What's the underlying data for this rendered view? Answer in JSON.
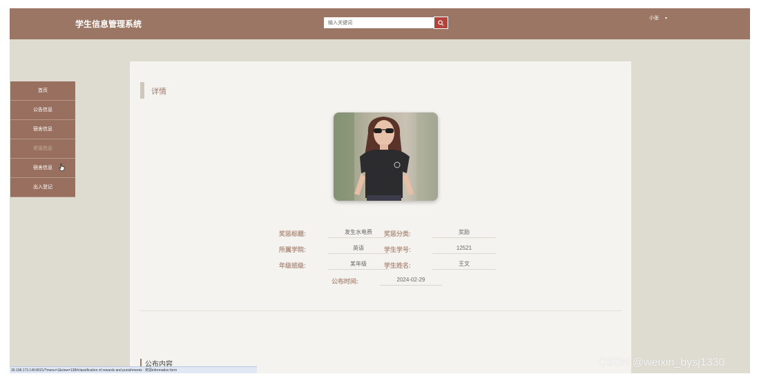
{
  "header": {
    "app_title": "学生信息管理系统",
    "search_placeholder": "输入关键词",
    "user_name": "小张",
    "user_caret": "▾"
  },
  "sidebar": {
    "items": [
      {
        "label": "首页"
      },
      {
        "label": "公告信息"
      },
      {
        "label": "宿舍信息"
      },
      {
        "label": "奖惩信息",
        "active": true
      },
      {
        "label": "宿舍信息"
      },
      {
        "label": "出入登记"
      }
    ]
  },
  "detail": {
    "section_title": "详情",
    "fields": {
      "title_label": "奖惩标题:",
      "title_value": "发生水电费",
      "category_label": "奖惩分类:",
      "category_value": "奖励",
      "college_label": "所属学院:",
      "college_value": "英语",
      "student_no_label": "学生学号:",
      "student_no_value": "12521",
      "grade_label": "年级班级:",
      "grade_value": "某年级",
      "student_name_label": "学生姓名:",
      "student_name_value": "王文",
      "publish_time_label": "公布时间:",
      "publish_time_value": "2024-02-29"
    },
    "content_title": "公布内容"
  },
  "statusbar": {
    "text": "39.108.173.140:8021/?menu=1&view=138#classification of rewards and punishments · 奖惩information form"
  },
  "watermark": "CSDN @weixin_bysj1330",
  "colors": {
    "header_bg": "#9b7664",
    "sidebar_bg": "#99705f",
    "page_bg": "#dedbd1",
    "panel_bg": "#f4f3ef",
    "search_button": "#b1453c",
    "label_color": "#b39384"
  }
}
